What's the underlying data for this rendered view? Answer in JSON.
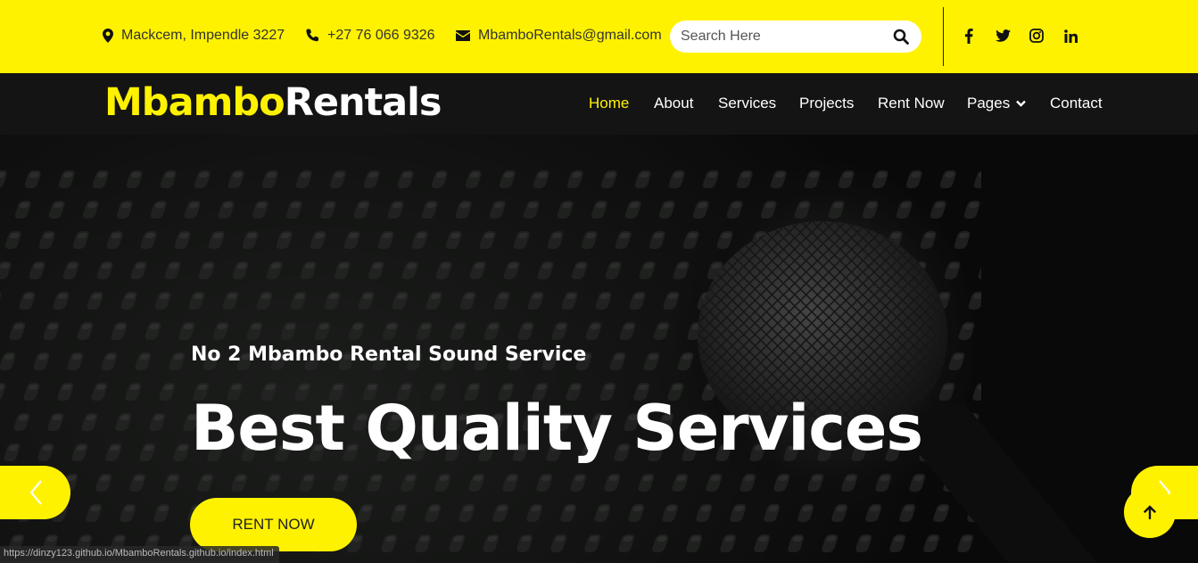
{
  "topbar": {
    "address": "Mackcem, Impendle 3227",
    "phone": "+27 76 066 9326",
    "email": "MbamboRentals@gmail.com",
    "search_placeholder": "Search Here",
    "icons": {
      "address": "map-marker-icon",
      "phone": "phone-icon",
      "email": "envelope-icon",
      "search": "search-icon"
    },
    "social": [
      "facebook-icon",
      "twitter-icon",
      "instagram-icon",
      "linkedin-icon"
    ]
  },
  "brand": {
    "part1": "Mbambo",
    "part2": "Rentals",
    "accent": "#fff200",
    "dark": "#141414"
  },
  "nav": {
    "items": [
      {
        "label": "Home",
        "active": true
      },
      {
        "label": "About"
      },
      {
        "label": "Services"
      },
      {
        "label": "Projects"
      },
      {
        "label": "Rent Now"
      },
      {
        "label": "Pages",
        "dropdown": true
      },
      {
        "label": "Contact"
      }
    ]
  },
  "hero": {
    "subtitle": "No 2 Mbambo Rental Sound Service",
    "title": "Best Quality Services",
    "button": "RENT NOW"
  },
  "status_bar": {
    "url": "https://dinzy123.github.io/MbamboRentals.github.io/index.html"
  }
}
